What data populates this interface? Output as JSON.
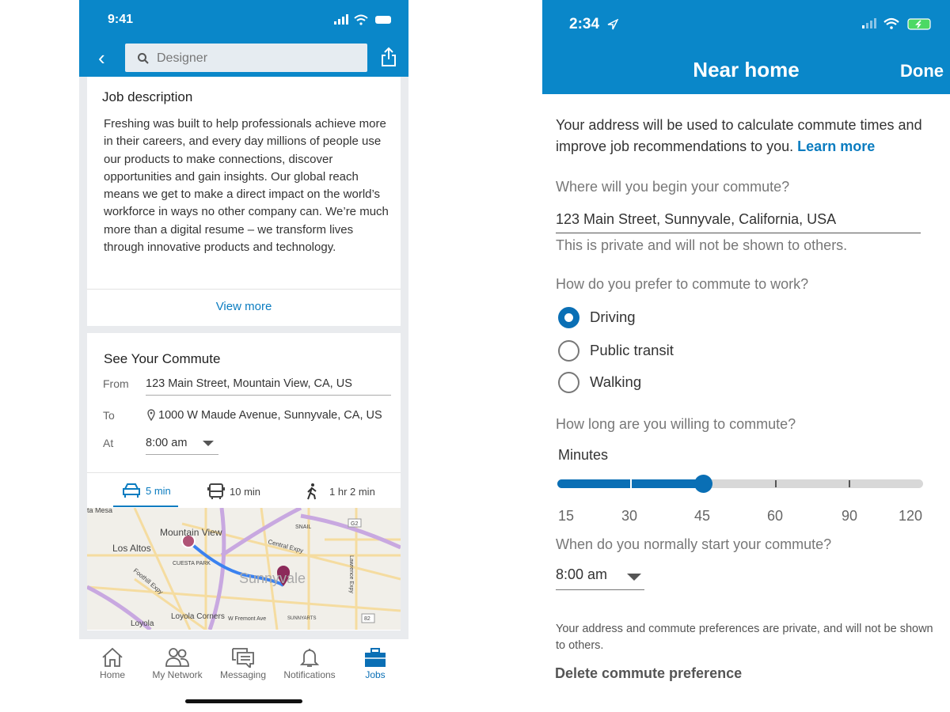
{
  "left_screen": {
    "status": {
      "time": "9:41"
    },
    "search": {
      "placeholder": "Designer"
    },
    "job_description": {
      "title": "Job description",
      "body": "Freshing was built to help professionals achieve more in their careers, and every day millions of people use our products to make connections, discover opportunities and gain insights. Our global reach means we get to make a direct impact on the world’s workforce in ways no other company can. We’re much more than a digital resume – we transform lives through innovative products and technology.",
      "view_more": "View more"
    },
    "commute": {
      "title": "See Your Commute",
      "from_label": "From",
      "from_value": "123 Main Street, Mountain View, CA, US",
      "to_label": "To",
      "to_value": "1000 W Maude Avenue, Sunnyvale, CA, US",
      "at_label": "At",
      "at_value": "8:00 am",
      "modes": [
        {
          "icon": "car-icon",
          "label": "5 min",
          "selected": true
        },
        {
          "icon": "bus-icon",
          "label": "10 min"
        },
        {
          "icon": "walk-icon",
          "label": "1 hr 2 min"
        }
      ],
      "map_labels": [
        "ta Mesa",
        "Mountain View",
        "Los Altos",
        "CUESTA PARK",
        "Sunnyvale",
        "Central Expy",
        "SNAIL",
        "Foothill Expy",
        "Lawrence Expy",
        "Loyola Corners",
        "Loyola",
        "W Fremont Ave",
        "SUNNYARTS",
        "G2",
        "82"
      ]
    },
    "nav": [
      {
        "label": "Home",
        "icon": "home-icon"
      },
      {
        "label": "My Network",
        "icon": "network-icon"
      },
      {
        "label": "Messaging",
        "icon": "messaging-icon"
      },
      {
        "label": "Notifications",
        "icon": "bell-icon"
      },
      {
        "label": "Jobs",
        "icon": "briefcase-icon",
        "active": true
      }
    ]
  },
  "right_screen": {
    "status": {
      "time": "2:34"
    },
    "header": {
      "title": "Near home",
      "done": "Done"
    },
    "intro": "Your address will be used to calculate commute times and improve job recommendations to you.",
    "learn_more": "Learn more",
    "begin_q": "Where will you begin your commute?",
    "address": "123 Main Street, Sunnyvale, California, USA",
    "private_note": "This is private and will not be shown to others.",
    "mode_q": "How do you prefer to commute to work?",
    "modes": [
      {
        "label": "Driving",
        "selected": true
      },
      {
        "label": "Public transit",
        "selected": false
      },
      {
        "label": "Walking",
        "selected": false
      }
    ],
    "duration_q": "How long are you willing to commute?",
    "slider": {
      "label": "Minutes",
      "ticks": [
        "15",
        "30",
        "45",
        "60",
        "90",
        "120"
      ],
      "value": 45
    },
    "start_q": "When do you normally start your commute?",
    "start_time": "8:00 am",
    "footer_note": "Your address and commute preferences are private, and will not be shown to others.",
    "delete": "Delete commute preference",
    "colors": {
      "brand": "#0a87c9",
      "accent": "#0a6fb5",
      "link": "#0a7cc0"
    }
  }
}
